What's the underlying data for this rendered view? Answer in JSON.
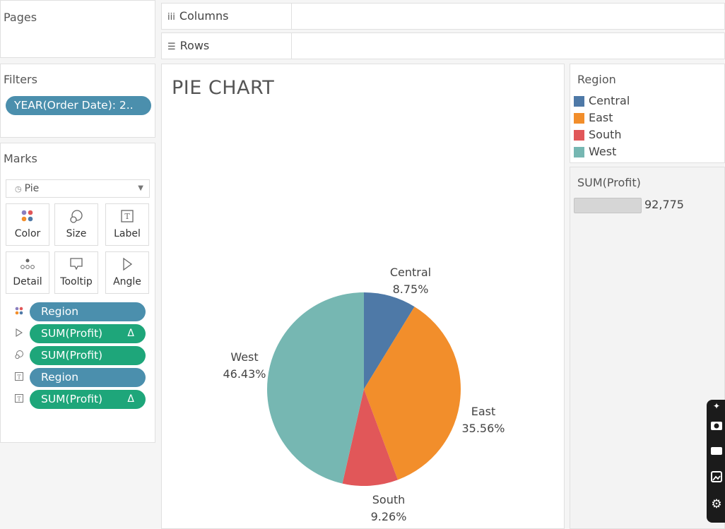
{
  "left_panel": {
    "pages_title": "Pages",
    "filters_title": "Filters",
    "filter_pill": "YEAR(Order Date): 2..",
    "marks_title": "Marks",
    "mark_type": "Pie",
    "mark_buttons": [
      {
        "label": "Color",
        "icon": "color-dots-icon"
      },
      {
        "label": "Size",
        "icon": "size-icon"
      },
      {
        "label": "Label",
        "icon": "label-icon"
      },
      {
        "label": "Detail",
        "icon": "detail-icon"
      },
      {
        "label": "Tooltip",
        "icon": "tooltip-icon"
      },
      {
        "label": "Angle",
        "icon": "angle-icon"
      }
    ],
    "mark_fields": [
      {
        "label": "Region",
        "icon": "color-dots-icon",
        "style": "blue",
        "delta": ""
      },
      {
        "label": "SUM(Profit)",
        "icon": "angle-icon",
        "style": "green",
        "delta": "Δ"
      },
      {
        "label": "SUM(Profit)",
        "icon": "size-icon",
        "style": "green",
        "delta": ""
      },
      {
        "label": "Region",
        "icon": "label-icon",
        "style": "blue",
        "delta": ""
      },
      {
        "label": "SUM(Profit)",
        "icon": "label-icon",
        "style": "green",
        "delta": "Δ"
      }
    ]
  },
  "shelves": {
    "columns_label": "Columns",
    "rows_label": "Rows"
  },
  "sheet": {
    "title": "PIE CHART"
  },
  "legend": {
    "title": "Region",
    "items": [
      {
        "label": "Central",
        "color": "#4e79a7"
      },
      {
        "label": "East",
        "color": "#f28e2b"
      },
      {
        "label": "South",
        "color": "#e15759"
      },
      {
        "label": "West",
        "color": "#76b7b2"
      }
    ]
  },
  "size_legend": {
    "title": "SUM(Profit)",
    "value": "92,775"
  },
  "toolbar": {
    "icons": [
      "pin-icon",
      "camera-icon",
      "video-icon",
      "gallery-icon",
      "settings-icon"
    ]
  },
  "chart_data": {
    "type": "pie",
    "title": "PIE CHART",
    "categories": [
      "Central",
      "East",
      "South",
      "West"
    ],
    "values": [
      8.75,
      35.56,
      9.26,
      46.43
    ],
    "value_labels": [
      "8.75%",
      "35.56%",
      "9.26%",
      "46.43%"
    ],
    "colors": [
      "#4e79a7",
      "#f28e2b",
      "#e15759",
      "#76b7b2"
    ],
    "start": "top, clockwise"
  }
}
